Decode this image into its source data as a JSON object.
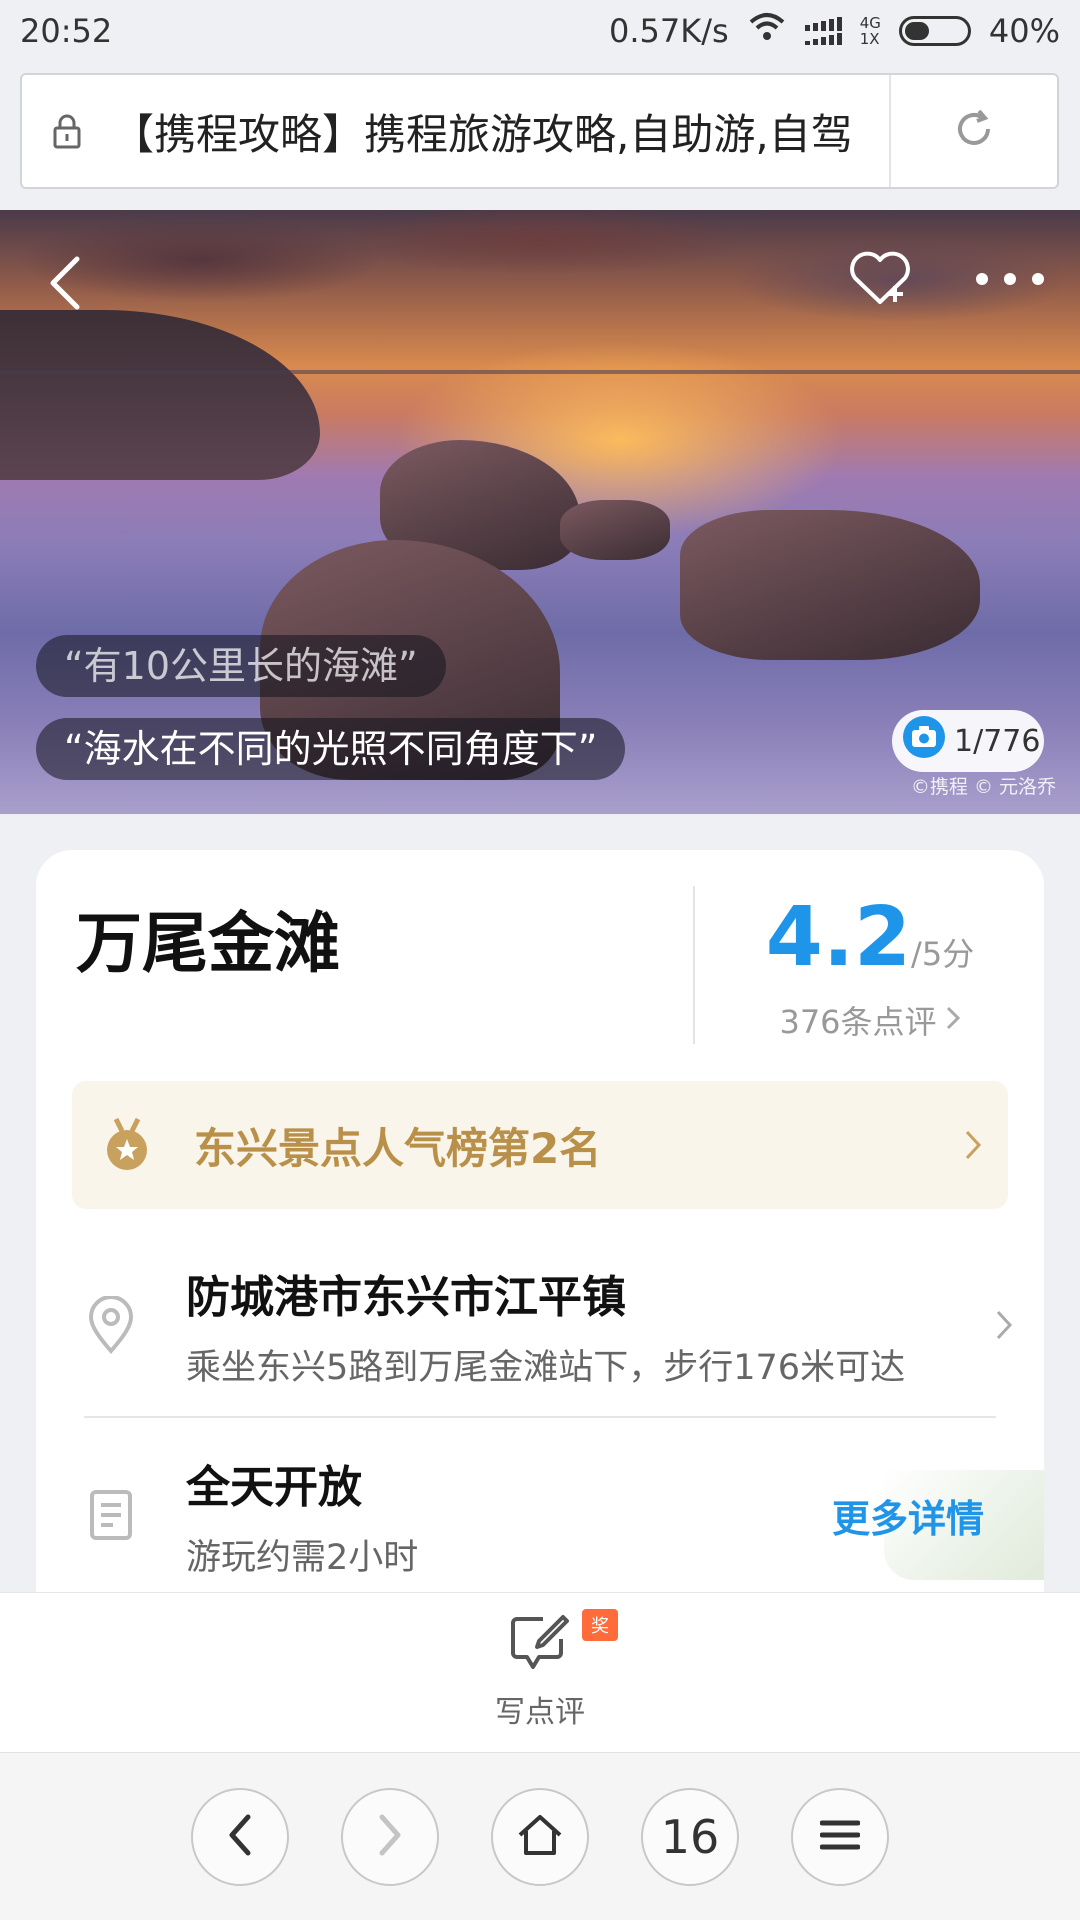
{
  "status_bar": {
    "time": "20:52",
    "net_speed": "0.57K/s",
    "network_top": "4G",
    "network_bottom": "1X",
    "battery": "40%",
    "battery_level": 0.4
  },
  "browser": {
    "url_title": "【携程攻略】携程旅游攻略,自助游,自驾",
    "tab_count": "16"
  },
  "hero": {
    "quotes": [
      "“有10公里长的海滩”",
      "“海水在不同的光照不同角度下”"
    ],
    "photo_counter": "1/776",
    "photo_credit": "©携程 © 元洛乔"
  },
  "poi": {
    "title": "万尾金滩",
    "rating": "4.2",
    "rating_suffix": "/5分",
    "review_count": "376条点评",
    "rank_text": "东兴景点人气榜第2名",
    "address": "防城港市东兴市江平镇",
    "transport": "乘坐东兴5路到万尾金滩站下，步行176米可达",
    "hours": "全天开放",
    "duration": "游玩约需2小时",
    "more_details": "更多详情"
  },
  "actions": {
    "write_review": "写点评",
    "award_badge": "奖"
  },
  "colors": {
    "accent_blue": "#1f95ea",
    "rank_gold": "#b8904a",
    "badge_orange": "#ff6b3b"
  },
  "icons": [
    "lock-icon",
    "reload-icon",
    "back-arrow-icon",
    "favorite-heart-icon",
    "more-dots-icon",
    "camera-icon",
    "medal-icon",
    "location-pin-icon",
    "document-icon",
    "edit-icon",
    "chevron-right-icon",
    "home-icon",
    "menu-icon"
  ]
}
